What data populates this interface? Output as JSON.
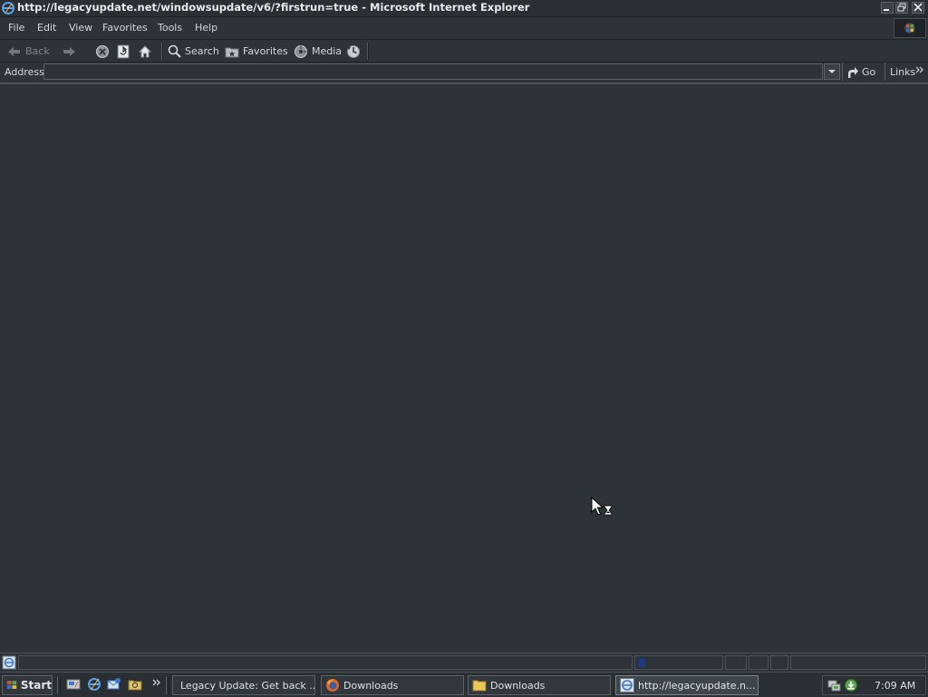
{
  "window": {
    "title": "http://legacyupdate.net/windowsupdate/v6/?firstrun=true - Microsoft Internet Explorer"
  },
  "menu": [
    "File",
    "Edit",
    "View",
    "Favorites",
    "Tools",
    "Help"
  ],
  "toolbar": {
    "back_label": "Back",
    "search_label": "Search",
    "favorites_label": "Favorites",
    "media_label": "Media"
  },
  "address": {
    "label": "Address",
    "value": "",
    "go_label": "Go",
    "links_label": "Links"
  },
  "taskbar": {
    "start_label": "Start",
    "tasks": [
      {
        "label": "Legacy Update: Get back ...",
        "icon": "firefox-icon",
        "active": false
      },
      {
        "label": "Downloads",
        "icon": "firefox-icon",
        "active": false
      },
      {
        "label": "Downloads",
        "icon": "folder-icon",
        "active": false
      },
      {
        "label": "http://legacyupdate.n...",
        "icon": "ie-icon",
        "active": true
      }
    ],
    "clock": "7:09 AM"
  },
  "colors": {
    "background": "#2d3338",
    "text": "#d4d8db",
    "progress": "#1e3a7a"
  }
}
